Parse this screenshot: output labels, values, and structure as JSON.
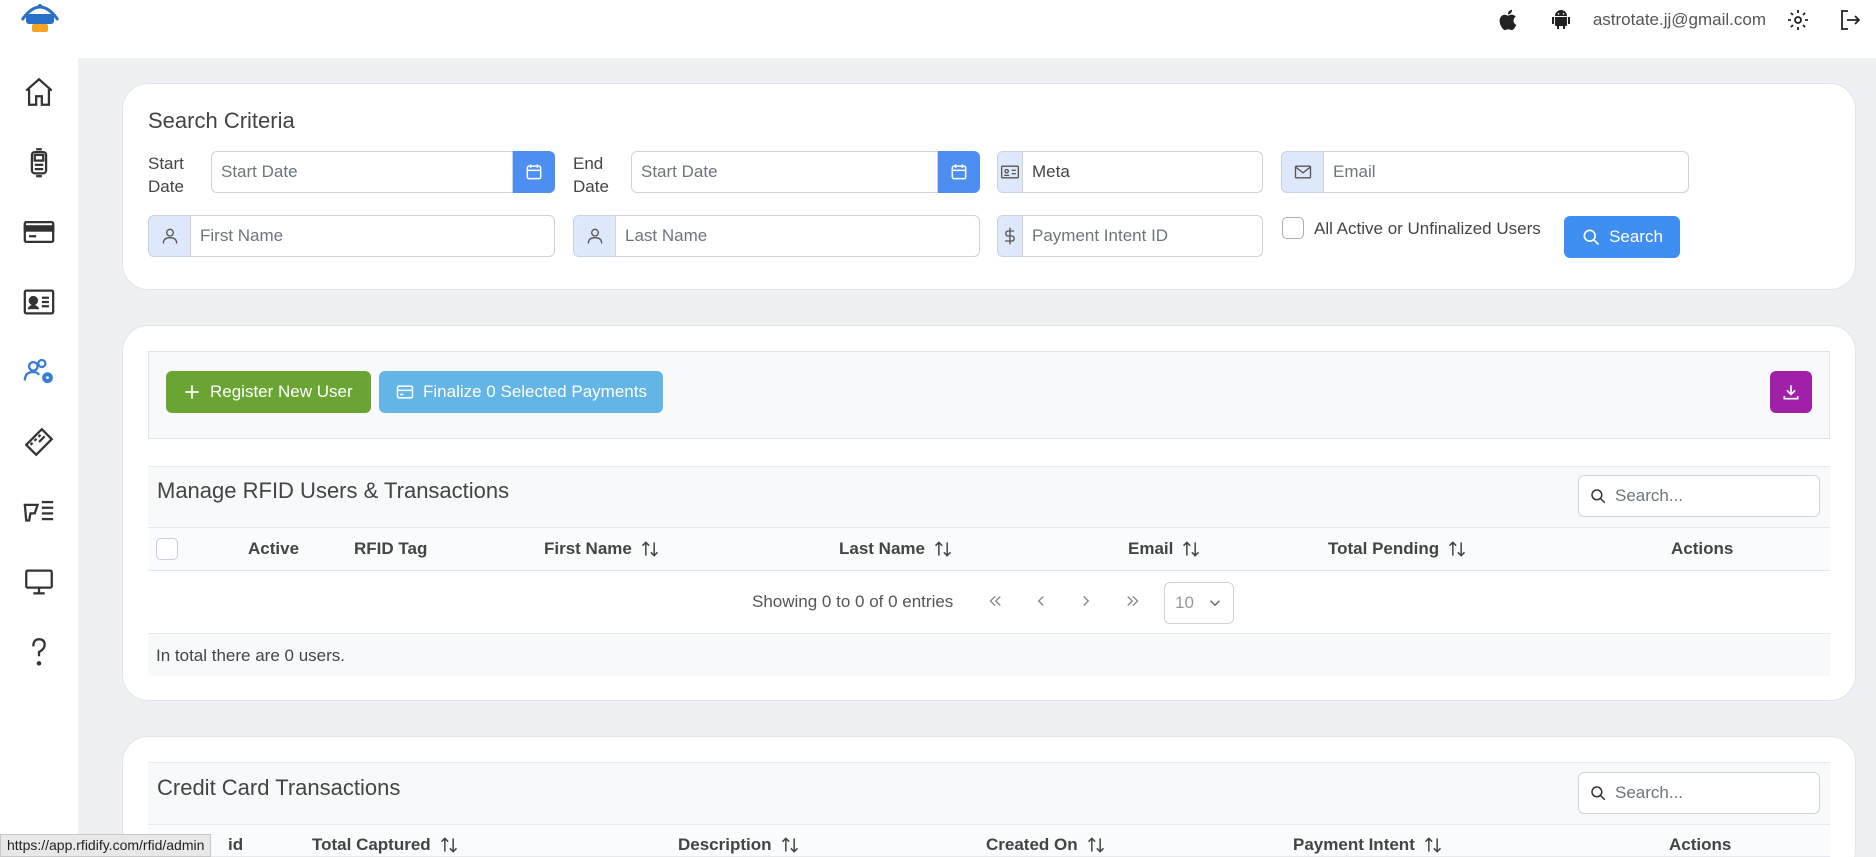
{
  "header": {
    "user_email": "astrotate.jj@gmail.com"
  },
  "sidebar": {
    "items": [
      {
        "name": "home",
        "icon": "home-icon"
      },
      {
        "name": "rfid-reader",
        "icon": "device-icon"
      },
      {
        "name": "payments",
        "icon": "credit-card-icon"
      },
      {
        "name": "contacts",
        "icon": "id-card-icon"
      },
      {
        "name": "users-settings",
        "icon": "users-gear-icon",
        "active": true
      },
      {
        "name": "tickets",
        "icon": "ticket-icon"
      },
      {
        "name": "scanner",
        "icon": "scanner-icon"
      },
      {
        "name": "display",
        "icon": "monitor-icon"
      },
      {
        "name": "help",
        "icon": "question-icon"
      }
    ]
  },
  "search_criteria": {
    "title": "Search Criteria",
    "start_date_label_1": "Start",
    "start_date_label_2": "Date",
    "start_date_placeholder": "Start Date",
    "end_date_label_1": "End",
    "end_date_label_2": "Date",
    "end_date_placeholder": "Start Date",
    "meta_value": "Meta",
    "email_placeholder": "Email",
    "first_name_placeholder": "First Name",
    "last_name_placeholder": "Last Name",
    "payment_intent_placeholder": "Payment Intent ID",
    "all_active_label": "All Active or Unfinalized Users",
    "search_button": "Search"
  },
  "toolbar": {
    "register_label": "Register New User",
    "finalize_label": "Finalize 0 Selected Payments"
  },
  "users_table": {
    "title": "Manage RFID Users & Transactions",
    "search_placeholder": "Search...",
    "columns": [
      "Active",
      "RFID Tag",
      "First Name",
      "Last Name",
      "Email",
      "Total Pending",
      "Actions"
    ],
    "showing": "Showing 0 to 0 of 0 entries",
    "page_size": "10",
    "total_text": "In total there are 0 users."
  },
  "cc_table": {
    "title": "Credit Card Transactions",
    "search_placeholder": "Search...",
    "columns": [
      "id",
      "Total Captured",
      "Description",
      "Created On",
      "Payment Intent",
      "Actions"
    ]
  },
  "statusbar": {
    "url": "https://app.rfidify.com/rfid/admin"
  },
  "colors": {
    "primary": "#3f8ef1",
    "success": "#6aa534",
    "info": "#63b5e6",
    "purple": "#a021a8"
  }
}
